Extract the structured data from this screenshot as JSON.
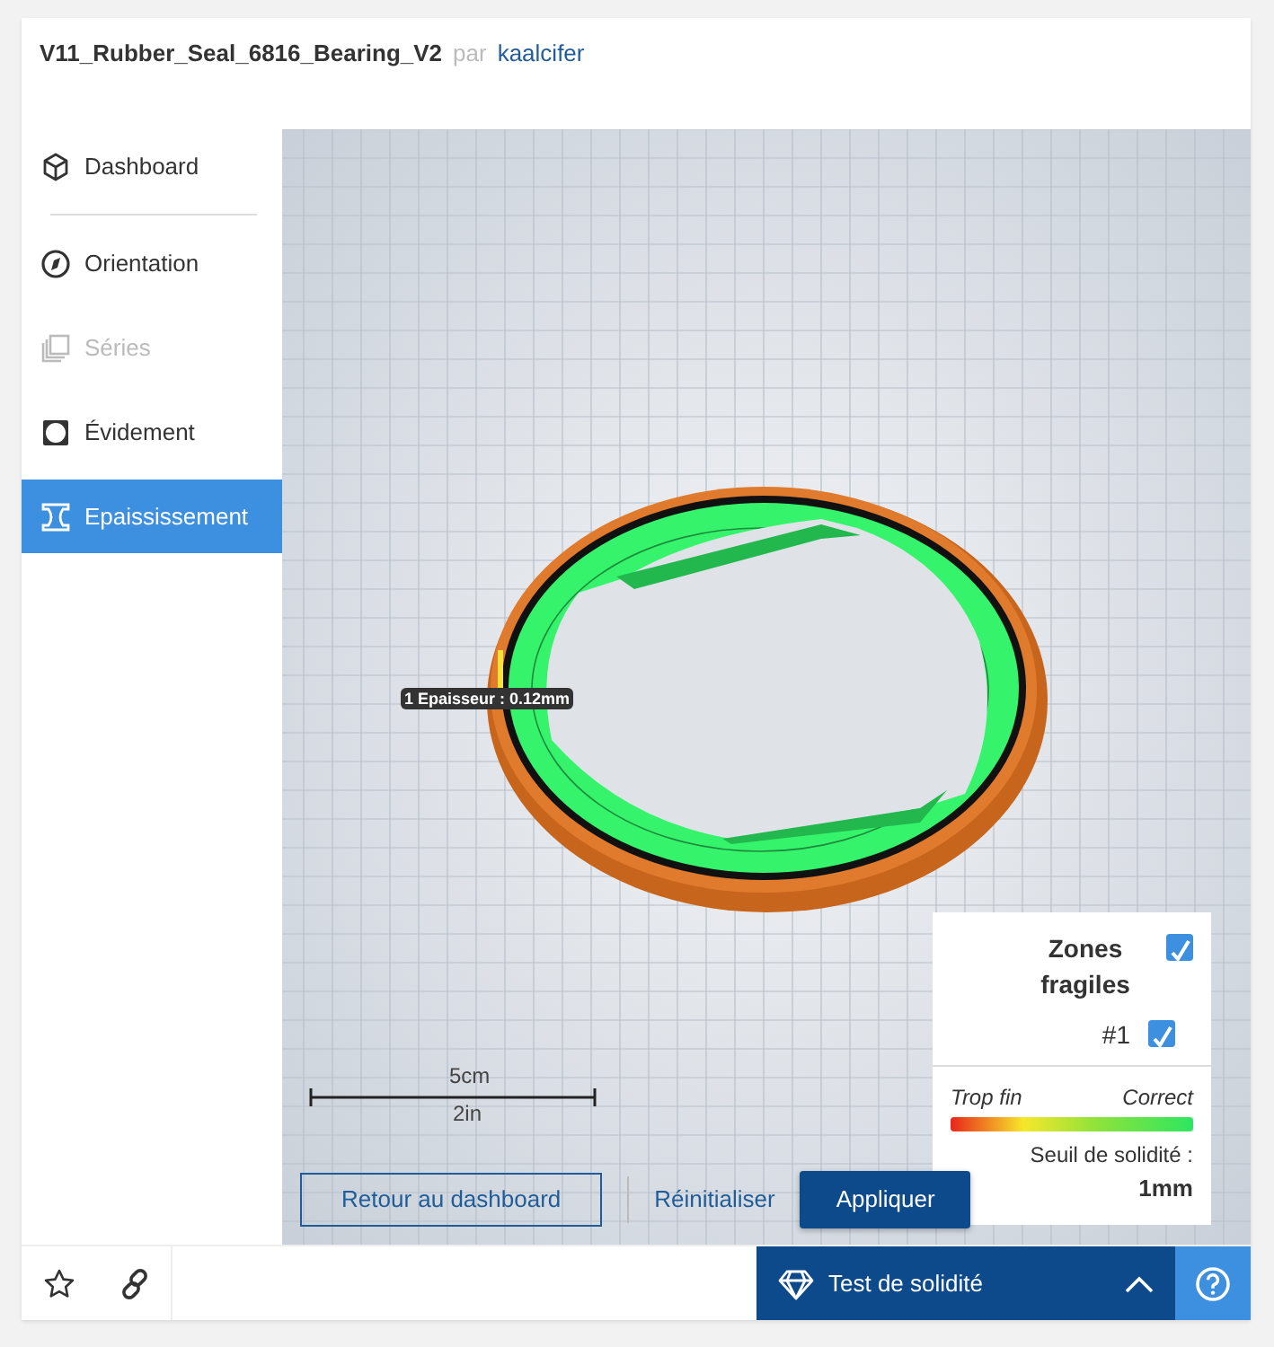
{
  "header": {
    "title": "V11_Rubber_Seal_6816_Bearing_V2",
    "by": "par",
    "author": "kaalcifer"
  },
  "sidebar": {
    "items": [
      {
        "label": "Dashboard",
        "selected": false,
        "disabled": false
      },
      {
        "label": "Orientation",
        "selected": false,
        "disabled": false
      },
      {
        "label": "Séries",
        "selected": false,
        "disabled": true
      },
      {
        "label": "Évidement",
        "selected": false,
        "disabled": false
      },
      {
        "label": "Epaississement",
        "selected": true,
        "disabled": false
      }
    ]
  },
  "viewport": {
    "tooltip": "1 Epaisseur : 0.12mm",
    "scale": {
      "metric": "5cm",
      "imperial": "2in"
    },
    "buttons": [
      {
        "label": "Retour au dashboard",
        "kind": "outline"
      },
      {
        "label": "Réinitialiser",
        "kind": "link"
      },
      {
        "label": "Appliquer",
        "kind": "primary"
      }
    ]
  },
  "panel": {
    "title": "Zones fragiles",
    "checked": true,
    "items": [
      {
        "label": "#1",
        "checked": true
      }
    ],
    "legend": {
      "low": "Trop fin",
      "high": "Correct"
    },
    "threshold_label": "Seuil de solidité :",
    "threshold": "1mm"
  },
  "footer": {
    "tool": "Test de solidité"
  }
}
